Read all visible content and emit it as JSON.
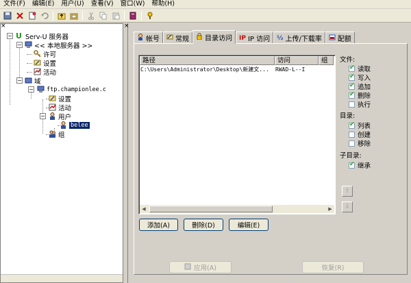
{
  "menu": [
    "文件(F)",
    "编辑(E)",
    "用户(U)",
    "查看(V)",
    "窗口(W)",
    "帮助(H)"
  ],
  "toolbar": {
    "icons": [
      "save-icon",
      "delete-icon",
      "new-icon",
      "undo-icon",
      "up-folder-icon",
      "folder-icon",
      "cut-icon",
      "copy-icon",
      "paste-icon",
      "book-icon",
      "help-icon"
    ]
  },
  "panel_close": "×",
  "tree": {
    "root": "Serv-U 服务器",
    "local_server": "<< 本地服务器 >>",
    "license": "许可",
    "settings": "设置",
    "activity": "活动",
    "domains": "域",
    "domain_name": "ftp.championlee.c",
    "domain_settings": "设置",
    "domain_activity": "活动",
    "users": "用户",
    "user_selected": "belee",
    "groups": "组"
  },
  "tabs": [
    {
      "label": "帐号",
      "icon": "account-icon"
    },
    {
      "label": "常规",
      "icon": "general-icon"
    },
    {
      "label": "目录访问",
      "icon": "lock-icon"
    },
    {
      "label": "IP 访问",
      "icon": "ip-icon"
    },
    {
      "label": "上传/下载率",
      "icon": "ratio-icon"
    },
    {
      "label": "配额",
      "icon": "quota-icon"
    }
  ],
  "dir_table": {
    "columns": [
      "路径",
      "访问",
      "组"
    ],
    "rows": [
      {
        "path": "C:\\Users\\Administrator\\Desktop\\新建文...",
        "access": "RWAD-L--I",
        "group": ""
      }
    ]
  },
  "files_group": {
    "title": "文件:",
    "items": [
      {
        "label": "读取",
        "checked": true
      },
      {
        "label": "写入",
        "checked": true
      },
      {
        "label": "追加",
        "checked": true
      },
      {
        "label": "删除",
        "checked": true
      },
      {
        "label": "执行",
        "checked": false
      }
    ]
  },
  "dirs_group": {
    "title": "目录:",
    "items": [
      {
        "label": "列表",
        "checked": true
      },
      {
        "label": "创建",
        "checked": false
      },
      {
        "label": "移除",
        "checked": false
      }
    ]
  },
  "subdirs_group": {
    "title": "子目录:",
    "items": [
      {
        "label": "继承",
        "checked": true
      }
    ]
  },
  "buttons": {
    "add": "添加(A)",
    "delete": "删除(D)",
    "edit": "编辑(E)",
    "apply": "应用(A)",
    "revert": "恢复(R)"
  }
}
